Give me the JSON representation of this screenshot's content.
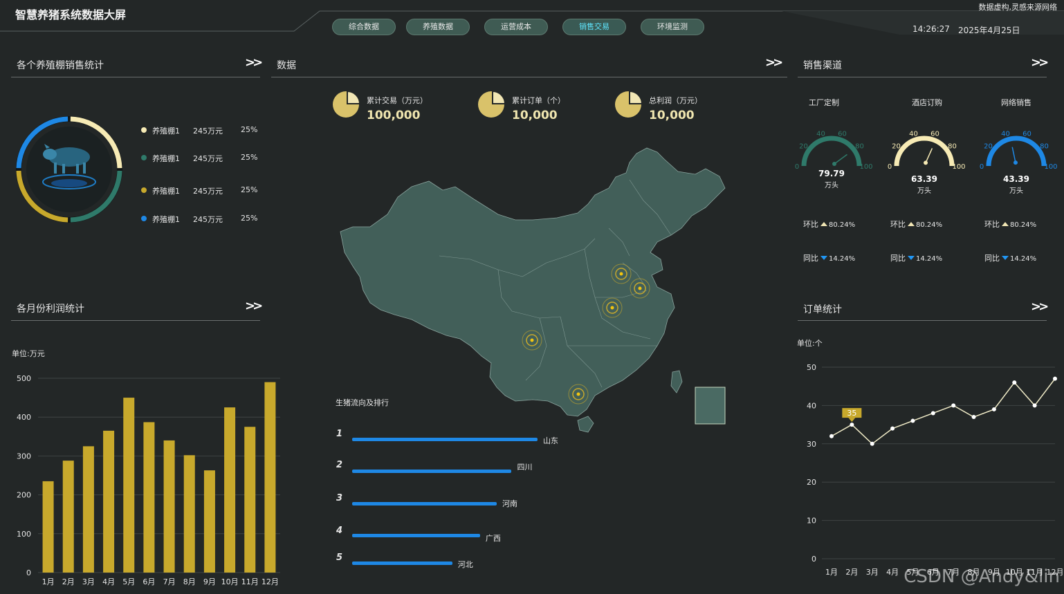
{
  "header": {
    "title": "智慧养猪系统数据大屏",
    "note": "数据虚构,灵感来源网络",
    "time": "14:26:27",
    "date": "2025年4月25日",
    "tabs": [
      {
        "label": "综合数据",
        "active": false
      },
      {
        "label": "养殖数据",
        "active": false
      },
      {
        "label": "运营成本",
        "active": false
      },
      {
        "label": "销售交易",
        "active": true
      },
      {
        "label": "环境监测",
        "active": false
      }
    ]
  },
  "panels": {
    "sales_by_barn": {
      "title": "各个养殖棚销售统计"
    },
    "monthly_profit": {
      "title": "各月份利润统计",
      "unit": "单位:万元"
    },
    "data": {
      "title": "数据"
    },
    "channels": {
      "title": "销售渠道"
    },
    "orders": {
      "title": "订单统计",
      "unit": "单位:个"
    }
  },
  "barn_legend": [
    {
      "name": "养殖棚1",
      "value": "245万元",
      "pct": "25%",
      "color": "#f7ebb5"
    },
    {
      "name": "养殖棚1",
      "value": "245万元",
      "pct": "25%",
      "color": "#2f7a6a"
    },
    {
      "name": "养殖棚1",
      "value": "245万元",
      "pct": "25%",
      "color": "#c8a92c"
    },
    {
      "name": "养殖棚1",
      "value": "245万元",
      "pct": "25%",
      "color": "#1e88e5"
    }
  ],
  "stats": [
    {
      "label": "累计交易（万元）",
      "value": "100,000"
    },
    {
      "label": "累计订单（个）",
      "value": "10,000"
    },
    {
      "label": "总利润（万元）",
      "value": "10,000"
    }
  ],
  "channels": [
    {
      "name": "工厂定制",
      "value": "79.79",
      "unit": "万头",
      "gauge": 79.79,
      "color": "#2f7a6a",
      "mom_label": "环比",
      "mom": "80.24%",
      "yoy_label": "同比",
      "yoy": "14.24%"
    },
    {
      "name": "酒店订购",
      "value": "63.39",
      "unit": "万头",
      "gauge": 63.39,
      "color": "#f7ebb5",
      "mom_label": "环比",
      "mom": "80.24%",
      "yoy_label": "同比",
      "yoy": "14.24%"
    },
    {
      "name": "网络销售",
      "value": "43.39",
      "unit": "万头",
      "gauge": 43.39,
      "color": "#1e88e5",
      "mom_label": "环比",
      "mom": "80.24%",
      "yoy_label": "同比",
      "yoy": "14.24%"
    }
  ],
  "gauge_ticks": [
    "0",
    "20",
    "40",
    "60",
    "80",
    "100"
  ],
  "ranking": {
    "title": "生猪流向及排行",
    "items": [
      {
        "rank": "1",
        "name": "山东",
        "value": 100
      },
      {
        "rank": "2",
        "name": "四川",
        "value": 86
      },
      {
        "rank": "3",
        "name": "河南",
        "value": 78
      },
      {
        "rank": "4",
        "name": "广西",
        "value": 69
      },
      {
        "rank": "5",
        "name": "河北",
        "value": 54
      }
    ]
  },
  "chart_data": [
    {
      "type": "bar",
      "categories": [
        "1月",
        "2月",
        "3月",
        "4月",
        "5月",
        "6月",
        "7月",
        "8月",
        "9月",
        "10月",
        "11月",
        "12月"
      ],
      "values": [
        235,
        288,
        325,
        365,
        450,
        387,
        340,
        302,
        263,
        425,
        375,
        490
      ],
      "ylim": [
        0,
        500
      ],
      "yticks": [
        "0",
        "100",
        "200",
        "300",
        "400",
        "500"
      ],
      "color": "#c8a92c"
    },
    {
      "type": "line",
      "categories": [
        "1月",
        "2月",
        "3月",
        "4月",
        "5月",
        "6月",
        "7月",
        "8月",
        "9月",
        "10月",
        "11月",
        "12月"
      ],
      "x_positions": [
        1,
        2,
        3,
        4,
        5,
        6,
        7,
        8,
        9,
        10,
        11,
        12,
        13,
        14,
        15,
        16,
        17
      ],
      "values": [
        32,
        35,
        30,
        34,
        36,
        38,
        40,
        37,
        39,
        46,
        40,
        47
      ],
      "ylim": [
        0,
        50
      ],
      "yticks": [
        "0",
        "10",
        "20",
        "30",
        "40",
        "50"
      ],
      "highlight": {
        "label": "35"
      },
      "color": "#f1ecc8"
    }
  ],
  "watermark": "CSDN @Andy&lin"
}
